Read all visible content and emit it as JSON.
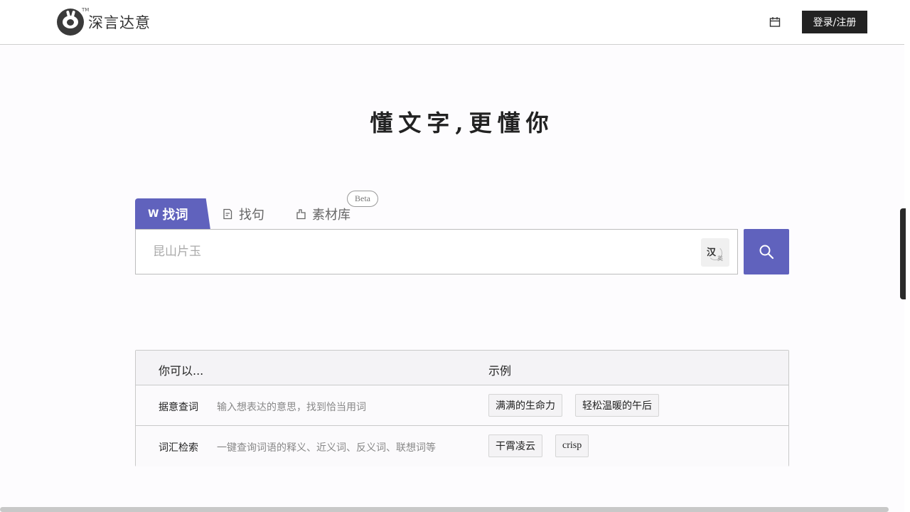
{
  "header": {
    "logo_text": "深言达意",
    "logo_tm": "TM",
    "calendar_icon": "calendar-icon",
    "login_label": "登录/注册"
  },
  "slogan": "懂文字,更懂你",
  "tabs": [
    {
      "label": "找词",
      "icon": "word-search-icon",
      "active": true
    },
    {
      "label": "找句",
      "icon": "sentence-icon",
      "active": false
    },
    {
      "label": "素材库",
      "icon": "material-icon",
      "active": false,
      "badge": "Beta"
    }
  ],
  "search": {
    "placeholder": "昆山片玉",
    "lang_toggle": {
      "primary": "汉",
      "secondary": "英"
    },
    "button_icon": "search-icon"
  },
  "table": {
    "headers": [
      "你可以...",
      "示例"
    ],
    "rows": [
      {
        "name": "据意查词",
        "desc": "输入想表达的意思，找到恰当用词",
        "examples": [
          "满满的生命力",
          "轻松温暖的午后"
        ]
      },
      {
        "name": "词汇检索",
        "desc": "一键查询词语的释义、近义词、反义词、联想词等",
        "examples": [
          "干霄凌云",
          "crisp"
        ]
      }
    ]
  },
  "colors": {
    "accent": "#6062bd",
    "dark": "#222222"
  }
}
